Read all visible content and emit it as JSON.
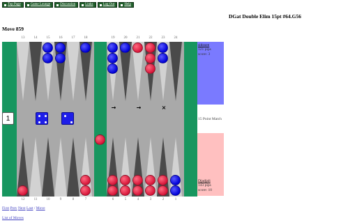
{
  "nav": [
    {
      "name": "nav-top-page",
      "label": "Top Page"
    },
    {
      "name": "nav-game-lounge",
      "label": "Game Lounge"
    },
    {
      "name": "nav-discussion",
      "label": "Discussion"
    },
    {
      "name": "nav-links",
      "label": "Links"
    },
    {
      "name": "nav-log-out",
      "label": "Log Out"
    },
    {
      "name": "nav-help",
      "label": "Help"
    }
  ],
  "match_title": "DGat Double Elim 15pt #64.G56",
  "move_title": "Move 859",
  "point_numbers": {
    "top": [
      "13",
      "14",
      "15",
      "16",
      "17",
      "18",
      "19",
      "20",
      "21",
      "22",
      "23",
      "24"
    ],
    "bottom": [
      "12",
      "11",
      "10",
      "9",
      "8",
      "7",
      "6",
      "5",
      "4",
      "3",
      "2",
      "1"
    ]
  },
  "checkers": [
    {
      "slot": "t3",
      "color": "blue",
      "count": 2
    },
    {
      "slot": "t4",
      "color": "blue",
      "count": 2
    },
    {
      "slot": "t6",
      "color": "blue",
      "count": 1
    },
    {
      "slot": "t7",
      "color": "blue",
      "count": 3
    },
    {
      "slot": "t8",
      "color": "blue",
      "count": 1
    },
    {
      "slot": "t9",
      "color": "red",
      "count": 1
    },
    {
      "slot": "t10",
      "color": "red",
      "count": 3
    },
    {
      "slot": "t11",
      "color": "blue",
      "count": 2
    },
    {
      "slot": "b1",
      "color": "red",
      "count": 1
    },
    {
      "slot": "b6",
      "color": "red",
      "count": 2
    },
    {
      "slot": "b7",
      "color": "red",
      "count": 2
    },
    {
      "slot": "b8",
      "color": "red",
      "count": 2
    },
    {
      "slot": "b9",
      "color": "red",
      "count": 2
    },
    {
      "slot": "b10",
      "color": "red",
      "count": 2
    },
    {
      "slot": "b11",
      "color": "red",
      "count": 2
    },
    {
      "slot": "b12",
      "color": "blue",
      "count": 2
    },
    {
      "slot": "bar",
      "color": "red",
      "count": 1
    }
  ],
  "dice": [
    4,
    2
  ],
  "cube_value": "1",
  "move_markers": [
    "→",
    "→",
    "×"
  ],
  "blue_player": {
    "name": "sidosee",
    "pips": "121 pips",
    "score": "score: 3"
  },
  "red_player": {
    "name": "Djadjali",
    "pips": "143 pips",
    "score": "score: 10"
  },
  "match_length": "15 Point Match",
  "links": {
    "first": "First",
    "prev": "Prev",
    "next": "Next",
    "last": "Last",
    "sep": "/",
    "move": "Move",
    "list_of_moves": "List of Moves"
  },
  "colors": {
    "board": "#17965f",
    "blue_checker": "#0000d8",
    "red_checker": "#d8163a"
  }
}
